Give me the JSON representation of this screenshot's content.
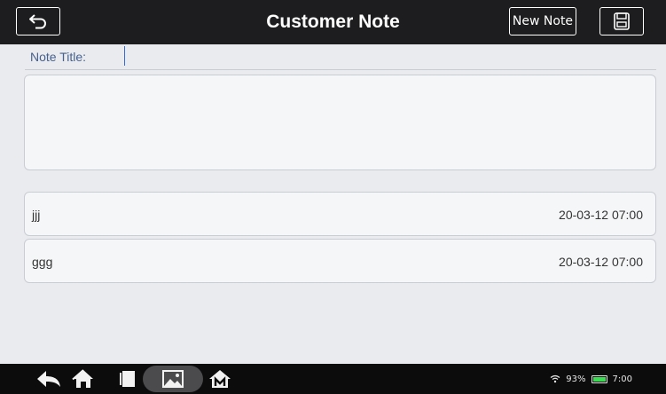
{
  "header": {
    "title": "Customer Note",
    "new_note_label": "New Note",
    "back_icon": "back-arrow-icon",
    "save_icon": "floppy-disk-icon"
  },
  "form": {
    "title_label": "Note Title:",
    "title_value": "",
    "content_value": ""
  },
  "notes": [
    {
      "title": "jjj",
      "date": "20-03-12 07:00"
    },
    {
      "title": "ggg",
      "date": "20-03-12 07:00"
    }
  ],
  "navbar": {
    "icons": [
      "back-icon",
      "home-icon",
      "recents-icon",
      "gallery-icon",
      "m-home-icon"
    ]
  },
  "status": {
    "battery": "93%",
    "time": "7:00",
    "wifi_icon": "wifi-icon",
    "battery_level": 0.93,
    "battery_color": "#3ddc55"
  }
}
